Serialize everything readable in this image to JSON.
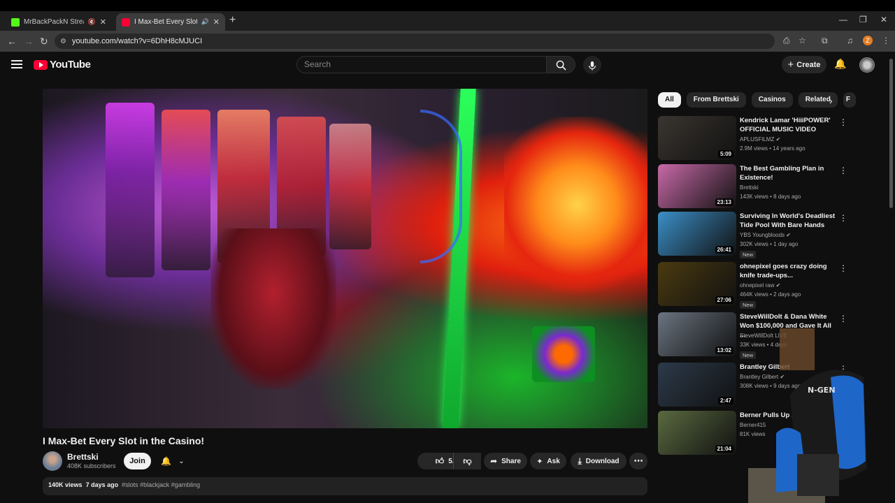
{
  "browser": {
    "tabs": [
      {
        "title": "MrBackPackN Stream - Wat",
        "active": false,
        "favicon_color": "#53fc18"
      },
      {
        "title": "I Max-Bet Every Slot in the C",
        "active": true,
        "favicon_color": "#ff0033"
      }
    ],
    "url": "youtube.com/watch?v=6DhH8cMJUCI",
    "profile_initial": "Z"
  },
  "header": {
    "logo_text": "YouTube",
    "search_placeholder": "Search",
    "create_label": "Create"
  },
  "video": {
    "title": "I Max-Bet Every Slot in the Casino!",
    "channel": "Brettski",
    "subscribers": "408K subscribers",
    "join_label": "Join",
    "likes": "5.5K",
    "share_label": "Share",
    "ask_label": "Ask",
    "download_label": "Download",
    "views": "140K views",
    "age": "7 days ago",
    "tags": "#slots #blackjack #gambling"
  },
  "chips": [
    "All",
    "From Brettski",
    "Casinos",
    "Related",
    "F"
  ],
  "recommendations": [
    {
      "title": "Kendrick Lamar 'HiiiPOWER' OFFICIAL MUSIC VIDEO",
      "channel": "APLUSFILMZ",
      "verified": true,
      "meta": "2.9M views • 14 years ago",
      "duration": "5:09",
      "badge": "",
      "thumb_color": "#3a3530"
    },
    {
      "title": "The Best Gambling Plan in Existence!",
      "channel": "Brettski",
      "verified": false,
      "meta": "143K views • 8 days ago",
      "duration": "23:13",
      "badge": "",
      "thumb_color": "#c86aa8"
    },
    {
      "title": "Surviving In World's Deadliest Tide Pool With Bare Hands",
      "channel": "YBS Youngbloods",
      "verified": true,
      "meta": "302K views • 1 day ago",
      "duration": "26:41",
      "badge": "New",
      "thumb_color": "#3b8fc7"
    },
    {
      "title": "ohnepixel goes crazy doing knife trade-ups...",
      "channel": "ohnepixel raw",
      "verified": true,
      "meta": "464K views • 2 days ago",
      "duration": "27:06",
      "badge": "New",
      "thumb_color": "#4a3a10"
    },
    {
      "title": "SteveWillDoIt & Dana White Won $100,000 and Gave It All ...",
      "channel": "SteveWillDoIt LIVE",
      "verified": false,
      "meta": "33K views • 4 days",
      "duration": "13:02",
      "badge": "New",
      "thumb_color": "#6a7480"
    },
    {
      "title": "Brantley Gilbert",
      "channel": "Brantley Gilbert",
      "verified": true,
      "meta": "308K views • 9 days ago",
      "duration": "2:47",
      "badge": "",
      "thumb_color": "#2c3a4a"
    },
    {
      "title": "Berner Pulls Up in the Wo",
      "channel": "Berner415",
      "verified": false,
      "meta": "81K views",
      "duration": "21:04",
      "badge": "",
      "thumb_color": "#5a6a40"
    }
  ],
  "colors": {
    "background": "#0f0f0f",
    "brand_red": "#ff0033",
    "chip_active": "#f1f1f1"
  }
}
